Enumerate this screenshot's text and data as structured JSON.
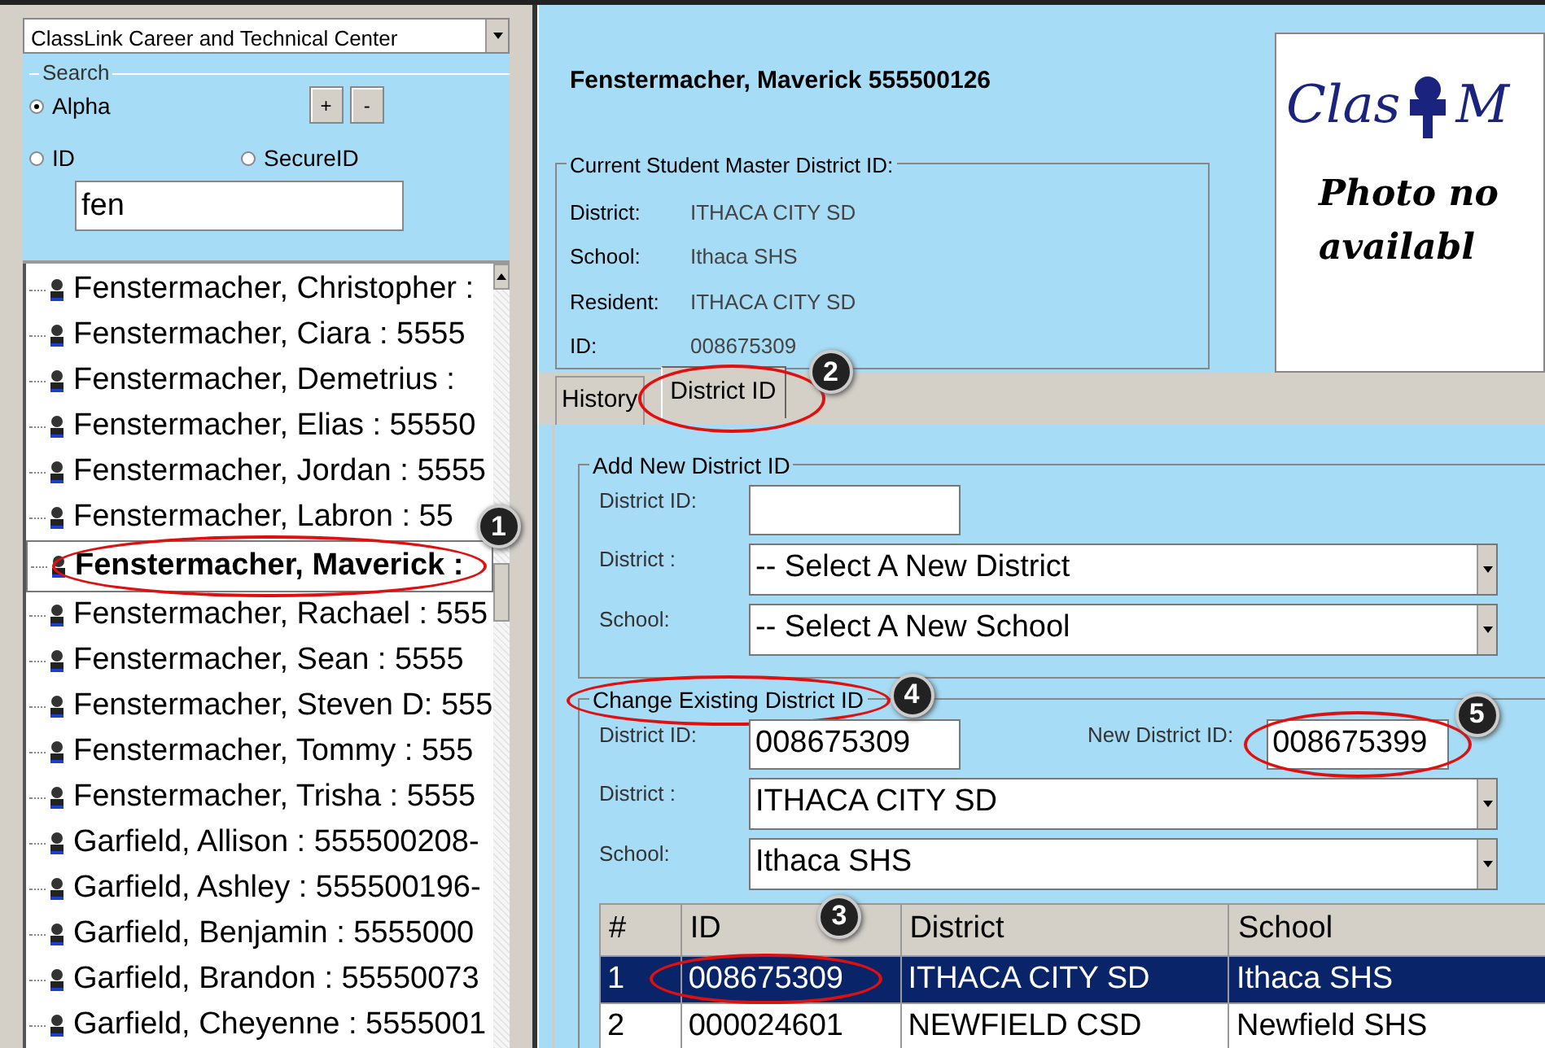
{
  "school_select": {
    "value": "ClassLink Career and Technical Center"
  },
  "search": {
    "legend": "Search",
    "options": [
      {
        "label": "Alpha",
        "selected": true
      },
      {
        "label": "ID",
        "selected": false
      },
      {
        "label": "SecureID",
        "selected": false
      }
    ],
    "buttons": [
      "+",
      "-"
    ],
    "value": "fen"
  },
  "students": [
    {
      "label": "Fenstermacher, Christopher :",
      "selected": false
    },
    {
      "label": "Fenstermacher, Ciara  : 5555",
      "selected": false
    },
    {
      "label": "Fenstermacher, Demetrius  :",
      "selected": false
    },
    {
      "label": "Fenstermacher, Elias : 55550",
      "selected": false
    },
    {
      "label": "Fenstermacher, Jordan : 5555",
      "selected": false
    },
    {
      "label": "Fenstermacher, Labron : 55",
      "selected": false
    },
    {
      "label": "Fenstermacher, Maverick :",
      "selected": true,
      "callout": "1"
    },
    {
      "label": "Fenstermacher, Rachael : 555",
      "selected": false
    },
    {
      "label": "Fenstermacher, Sean  : 5555",
      "selected": false
    },
    {
      "label": "Fenstermacher, Steven D: 555",
      "selected": false
    },
    {
      "label": "Fenstermacher, Tommy : 555",
      "selected": false
    },
    {
      "label": "Fenstermacher, Trisha : 5555",
      "selected": false
    },
    {
      "label": "Garfield, Allison  : 555500208-",
      "selected": false
    },
    {
      "label": "Garfield, Ashley : 555500196-",
      "selected": false
    },
    {
      "label": "Garfield, Benjamin  : 5555000",
      "selected": false
    },
    {
      "label": "Garfield, Brandon : 55550073",
      "selected": false
    },
    {
      "label": "Garfield, Cheyenne  : 5555001",
      "selected": false
    }
  ],
  "header": {
    "student": "Fenstermacher, Maverick  555500126"
  },
  "current_master": {
    "legend": "Current Student Master District ID:",
    "fields": [
      {
        "label": "District:",
        "value": "ITHACA CITY SD"
      },
      {
        "label": "School:",
        "value": "Ithaca SHS"
      },
      {
        "label": "Resident:",
        "value": "ITHACA CITY SD"
      },
      {
        "label": "ID:",
        "value": "008675309"
      }
    ]
  },
  "photo": {
    "logo": [
      "Clas",
      "M"
    ],
    "message": [
      "Photo no",
      "availabl"
    ]
  },
  "tabs": [
    {
      "label": "History",
      "selected": false
    },
    {
      "label": "District ID",
      "selected": true,
      "callout": "2"
    }
  ],
  "add_new": {
    "legend": "Add New District ID",
    "district_id_label": "District ID:",
    "district_label": "District :",
    "district": "-- Select A New District",
    "school_label": "School:",
    "school": "-- Select A New School"
  },
  "change_existing": {
    "legend": "Change Existing District ID",
    "legend_callout": "4",
    "district_id_label": "District ID:",
    "district_id": "008675309",
    "new_id_label": "New District ID:",
    "new_id": "008675399",
    "new_id_callout": "5",
    "district_label": "District :",
    "district": "ITHACA CITY SD",
    "school_label": "School:",
    "school": "Ithaca SHS"
  },
  "table": {
    "columns": [
      "#",
      "ID",
      "District",
      "School"
    ],
    "rows": [
      {
        "cells": [
          "1",
          "008675309",
          "ITHACA CITY SD",
          "Ithaca SHS"
        ],
        "selected": true,
        "id_callout": "3"
      },
      {
        "cells": [
          "2",
          "000024601",
          "NEWFIELD CSD",
          "Newfield SHS"
        ],
        "selected": false
      }
    ]
  }
}
